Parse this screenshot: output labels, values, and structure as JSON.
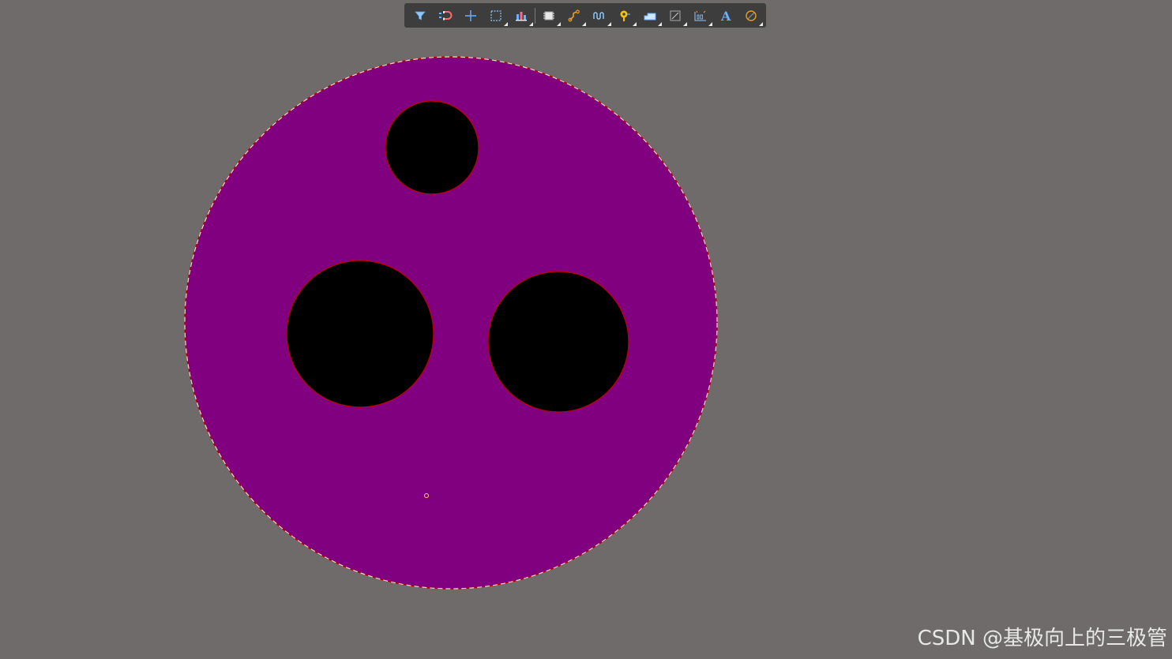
{
  "toolbar": {
    "buttons": [
      {
        "icon": "filter-icon"
      },
      {
        "icon": "snap-magnet-icon"
      },
      {
        "icon": "crosshair-icon"
      },
      {
        "icon": "select-rectangle-icon"
      },
      {
        "icon": "align-icon"
      },
      {
        "icon": "component-icon"
      },
      {
        "icon": "route-track-icon"
      },
      {
        "icon": "interactive-length-tuning-icon"
      },
      {
        "icon": "via-icon"
      },
      {
        "icon": "fill-polygon-icon"
      },
      {
        "icon": "region-icon"
      },
      {
        "icon": "dimension-icon"
      },
      {
        "icon": "text-string-icon"
      },
      {
        "icon": "arc-icon"
      }
    ]
  },
  "colors": {
    "background": "#6f6b6a",
    "board": "#800080",
    "holes": "#000000",
    "outline": "#c00000",
    "toolbar": "#3d3d3d"
  },
  "watermark": {
    "text": "CSDN @基极向上的三极管"
  }
}
